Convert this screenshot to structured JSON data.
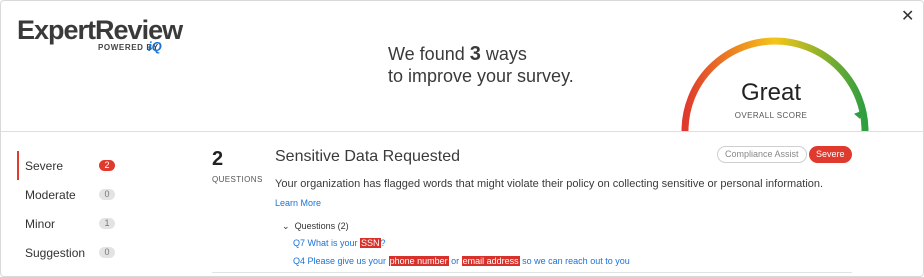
{
  "logo": {
    "name": "ExpertReview",
    "powered_by": "POWERED BY",
    "partner": "iQ"
  },
  "header": {
    "headline_prefix": "We found",
    "count": "3",
    "headline_suffix": "ways",
    "headline_line2": "to improve your survey.",
    "close_icon": "close-icon"
  },
  "score": {
    "label": "Great",
    "sublabel": "OVERALL SCORE",
    "level": 0.95,
    "colors": {
      "low": "#e0392e",
      "mid": "#f5c518",
      "high": "#2e9e3f"
    }
  },
  "sidebar": {
    "items": [
      {
        "label": "Severe",
        "count": "2"
      },
      {
        "label": "Moderate",
        "count": "0"
      },
      {
        "label": "Minor",
        "count": "1"
      },
      {
        "label": "Suggestion",
        "count": "0"
      }
    ],
    "active_index": 0
  },
  "issue": {
    "question_count": "2",
    "question_count_label": "QUESTIONS",
    "title": "Sensitive Data Requested",
    "description": "Your organization has flagged words that might violate their policy on collecting sensitive or personal information.",
    "learn_more": "Learn More",
    "questions_toggle": "Questions (2)",
    "badges": {
      "compliance": "Compliance Assist",
      "severity": "Severe"
    },
    "questions": [
      {
        "prefix": "Q7 What is your ",
        "flag1": "SSN",
        "middle": "?",
        "flag2": "",
        "suffix": ""
      },
      {
        "prefix": "Q4 Please give us your ",
        "flag1": "phone number",
        "middle": " or ",
        "flag2": "email address",
        "suffix": " so we can reach out to you"
      }
    ]
  }
}
